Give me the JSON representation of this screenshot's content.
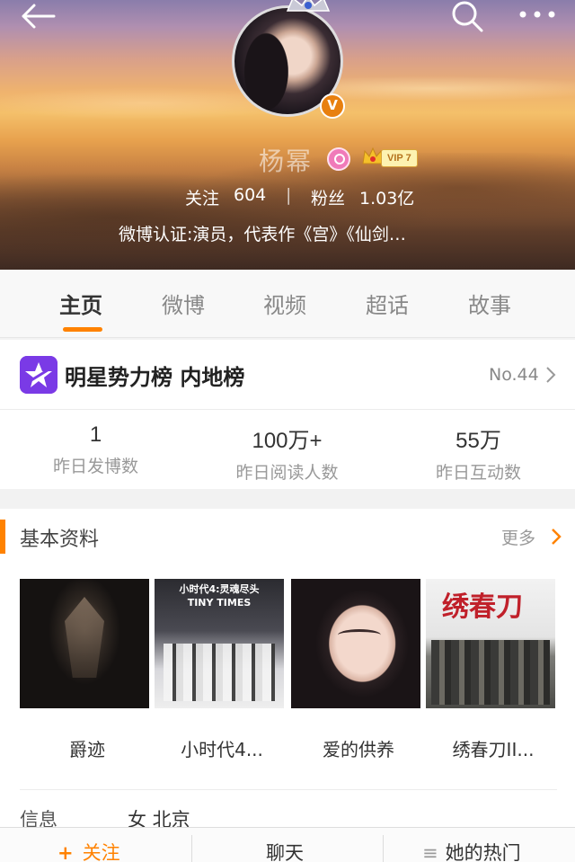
{
  "header": {
    "user_name": "杨幂",
    "verified_badge": "V",
    "vip_label": "VIP 7",
    "follow_label": "关注",
    "follow_count": "604",
    "divider": "|",
    "fans_label": "粉丝",
    "fans_count": "1.03亿",
    "verification": "微博认证:演员，代表作《宫》《仙剑…",
    "icons": [
      "back-arrow-icon",
      "search-icon",
      "more-icon"
    ],
    "colors": {
      "verified": "#e8800f",
      "vip_bg": "#fdf2b0"
    }
  },
  "tabs": {
    "items": [
      "主页",
      "微博",
      "视频",
      "超话",
      "故事"
    ],
    "active": "主页",
    "accent": "#ff8200"
  },
  "ranking": {
    "title": "明星势力榜 内地榜",
    "rank": "No.44",
    "stats": [
      {
        "value": "1",
        "label": "昨日发博数"
      },
      {
        "value": "100万+",
        "label": "昨日阅读人数"
      },
      {
        "value": "55万",
        "label": "昨日互动数"
      }
    ]
  },
  "basic_info": {
    "title": "基本资料",
    "more": "更多",
    "works": [
      {
        "title": "爵迹"
      },
      {
        "title": "小时代4..."
      },
      {
        "title": "爱的供养"
      },
      {
        "title": "绣春刀II..."
      }
    ],
    "poster_text": {
      "tiny_times_cn": "小时代4:灵魂尽头",
      "tiny_times_en": "TINY TIMES",
      "xiuchundao": "绣春刀"
    },
    "info_label": "信息",
    "info_value": "女 北京"
  },
  "bottom_bar": {
    "follow_plus": "+",
    "follow": "关注",
    "chat": "聊天",
    "hot_prefix": "≡",
    "hot": "她的热门"
  }
}
